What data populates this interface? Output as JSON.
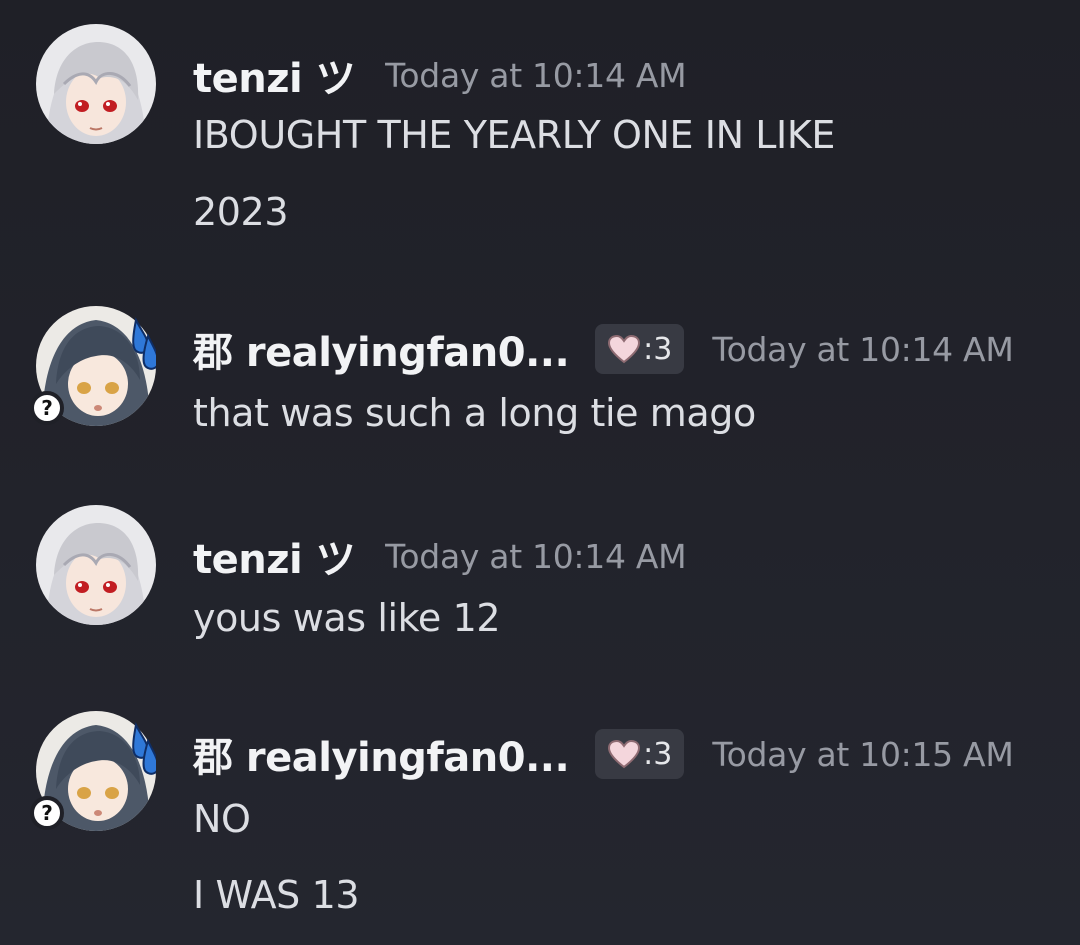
{
  "messages": [
    {
      "username": "tenzi ツ",
      "timestamp": "Today at 10:14 AM",
      "lines": [
        "IBOUGHT THE YEARLY ONE IN LIKE",
        "2023"
      ]
    },
    {
      "username": "郡 realyingfan0...",
      "tag": ":3",
      "timestamp": "Today at 10:14 AM",
      "lines": [
        "that was such a long tie mago"
      ],
      "badge": "?"
    },
    {
      "username": "tenzi ツ",
      "timestamp": "Today at 10:14 AM",
      "lines": [
        "yous was like 12"
      ]
    },
    {
      "username": "郡 realyingfan0...",
      "tag": ":3",
      "timestamp": "Today at 10:15 AM",
      "lines": [
        "NO",
        "I WAS 13"
      ],
      "badge": "?"
    }
  ],
  "colors": {
    "background": "#202129",
    "username": "#f2f3f5",
    "timestamp": "#979aa3",
    "message_text": "#dcdee3",
    "tag_background": "#383a43",
    "heart": "#f4d6dc"
  },
  "icons": {
    "heart": "pink-heart-icon",
    "badge": "question-mark-icon",
    "avatar_tenzi": "white-haired-anime-avatar",
    "avatar_realyingfan": "blue-haired-anime-avatar-with-sweat-drops"
  }
}
